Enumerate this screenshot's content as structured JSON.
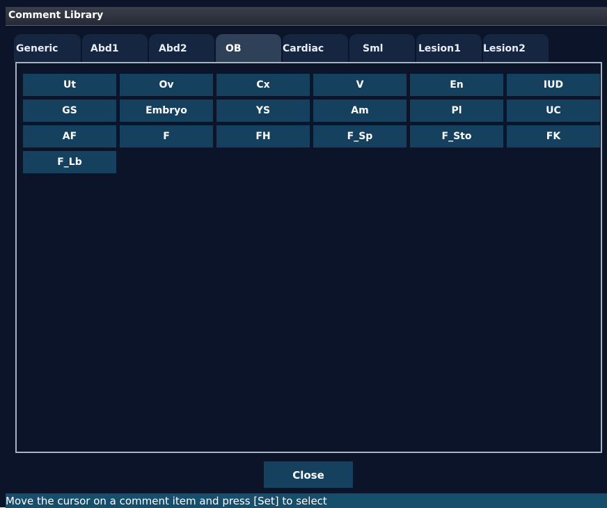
{
  "window": {
    "title": "Comment Library"
  },
  "tabs": [
    {
      "label": "Generic",
      "active": false
    },
    {
      "label": "Abd1",
      "active": false
    },
    {
      "label": "Abd2",
      "active": false
    },
    {
      "label": "OB",
      "active": true
    },
    {
      "label": "Cardiac",
      "active": false
    },
    {
      "label": "Sml",
      "active": false
    },
    {
      "label": "Lesion1",
      "active": false
    },
    {
      "label": "Lesion2",
      "active": false
    }
  ],
  "comments": [
    "Ut",
    "Ov",
    "Cx",
    "V",
    "En",
    "IUD",
    "GS",
    "Embryo",
    "YS",
    "Am",
    "Pl",
    "UC",
    "AF",
    "F",
    "FH",
    "F_Sp",
    "F_Sto",
    "FK",
    "F_Lb"
  ],
  "buttons": {
    "close_label": "Close"
  },
  "status": {
    "message": "Move the cursor on a comment item and press [Set] to select"
  },
  "colors": {
    "background": "#0b1428",
    "button": "#15405e",
    "tab": "#162640",
    "tab_active": "#2e4158",
    "status_bar": "#164e6c"
  }
}
